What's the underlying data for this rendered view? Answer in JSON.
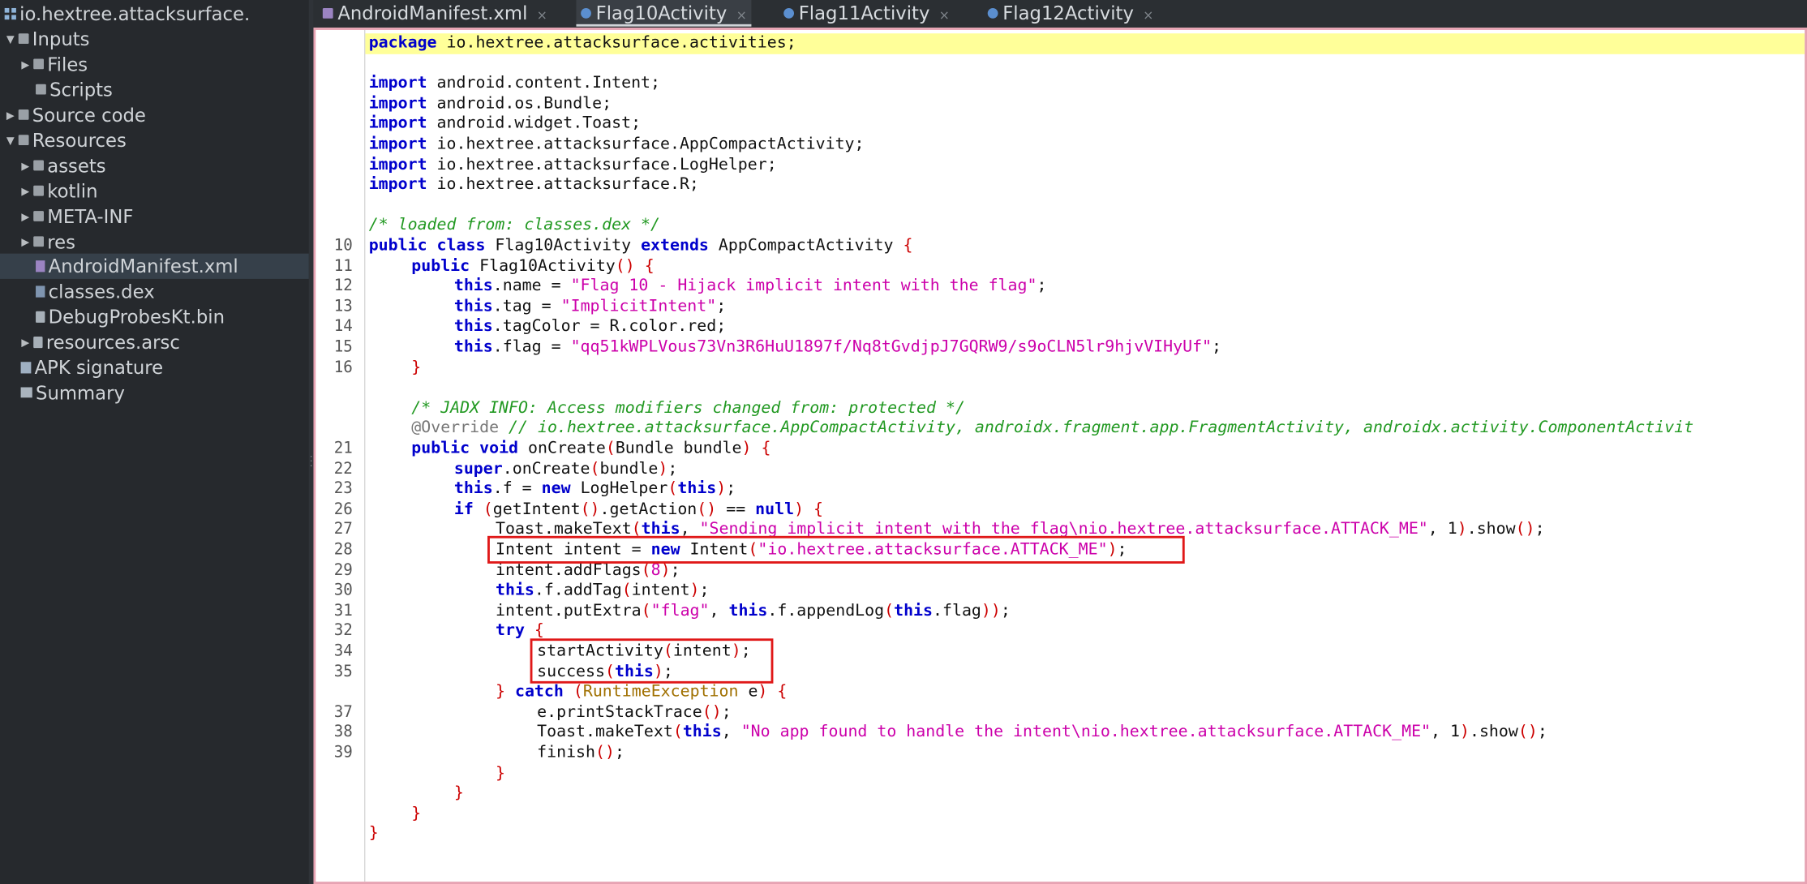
{
  "sidebar": {
    "root_label": "io.hextree.attacksurface.",
    "items": [
      {
        "label": "Inputs"
      },
      {
        "label": "Files"
      },
      {
        "label": "Scripts"
      },
      {
        "label": "Source code"
      },
      {
        "label": "Resources"
      },
      {
        "label": "assets"
      },
      {
        "label": "kotlin"
      },
      {
        "label": "META-INF"
      },
      {
        "label": "res"
      },
      {
        "label": "AndroidManifest.xml"
      },
      {
        "label": "classes.dex"
      },
      {
        "label": "DebugProbesKt.bin"
      },
      {
        "label": "resources.arsc"
      },
      {
        "label": "APK signature"
      },
      {
        "label": "Summary"
      }
    ]
  },
  "tabs": [
    {
      "label": "AndroidManifest.xml",
      "close": "×"
    },
    {
      "label": "Flag10Activity",
      "close": "×"
    },
    {
      "label": "Flag11Activity",
      "close": "×"
    },
    {
      "label": "Flag12Activity",
      "close": "×"
    }
  ],
  "code": {
    "line_numbers": [
      "10",
      "11",
      "12",
      "13",
      "14",
      "15",
      "16",
      "21",
      "22",
      "23",
      "26",
      "27",
      "28",
      "29",
      "30",
      "31",
      "32",
      "34",
      "35",
      "37",
      "38",
      "39"
    ],
    "package_kw": "package",
    "package_name": " io.hextree.attacksurface.activities;",
    "imports": [
      " android.content.Intent;",
      " android.os.Bundle;",
      " android.widget.Toast;",
      " io.hextree.attacksurface.AppCompactActivity;",
      " io.hextree.attacksurface.LogHelper;",
      " io.hextree.attacksurface.R;"
    ],
    "import_kw": "import",
    "loaded_comment": "/* loaded from: classes.dex */",
    "class_decl": {
      "public": "public",
      "class": "class",
      "name": " Flag10Activity ",
      "extends": "extends",
      "parent": " AppCompactActivity ",
      "open": "{"
    },
    "ctor": {
      "public": "public",
      "name": " Flag10Activity",
      "parens": "()",
      "open": " {"
    },
    "field_lines": [
      {
        "this": "this",
        "rest": ".name = ",
        "val": "\"Flag 10 - Hijack implicit intent with the flag\"",
        "end": ";"
      },
      {
        "this": "this",
        "rest": ".tag = ",
        "val": "\"ImplicitIntent\"",
        "end": ";"
      },
      {
        "this": "this",
        "rest": ".tagColor = R.color.red;",
        "val": "",
        "end": ""
      },
      {
        "this": "this",
        "rest": ".flag = ",
        "val": "\"qq51kWPLVous73Vn3R6HuU1897f/Nq8tGvdjpJ7GQRW9/s9oCLN5lr9hjvVIHyUf\"",
        "end": ";"
      }
    ],
    "close_brace": "}",
    "jadx_comment": "/* JADX INFO: Access modifiers changed from: protected */",
    "override": "@Override",
    "override_comment": " // io.hextree.attacksurface.AppCompactActivity, androidx.fragment.app.FragmentActivity, androidx.activity.ComponentActivit",
    "oncreate": {
      "public": "public",
      "void": "void",
      "name": " onCreate",
      "param": "Bundle bundle",
      "open": " {"
    },
    "super_kw": "super",
    "super_rest": ".onCreate",
    "super_arg": "bundle",
    "logf_this": "this",
    "logf_mid": ".f = ",
    "logf_new": "new",
    "logf_cls": " LogHelper",
    "logf_arg": "this",
    "if_kw": "if",
    "if_call1": "getIntent",
    "if_call2": ".getAction",
    "if_eq": " == ",
    "if_null": "null",
    "toast1_pre": "Toast.makeText",
    "toast1_this": "this",
    "toast1_str": "\"Sending implicit intent with the flag\\nio.hextree.attacksurface.ATTACK_ME\"",
    "toast1_post": ", 1",
    "toast_show": ".show",
    "intent_decl_pre": "Intent intent = ",
    "intent_new": "new",
    "intent_cls": " Intent",
    "intent_str": "\"io.hextree.attacksurface.ATTACK_ME\"",
    "addflags": "intent.addFlags",
    "addflags_arg": "8",
    "addtag_this": "this",
    "addtag_rest": ".f.addTag",
    "addtag_arg": "intent",
    "putextra": "intent.putExtra",
    "putextra_str": "\"flag\"",
    "putextra_this": "this",
    "putextra_mid": ".f.appendLog",
    "putextra_this2": "this",
    "putextra_end": ".flag",
    "try_kw": "try",
    "start_activity": "startActivity",
    "start_arg": "intent",
    "success": "success",
    "success_arg": "this",
    "catch_kw": "catch",
    "catch_type": "RuntimeException",
    "catch_var": " e",
    "print_stack": "e.printStackTrace",
    "toast2_pre": "Toast.makeText",
    "toast2_this": "this",
    "toast2_str": "\"No app found to handle the intent\\nio.hextree.attacksurface.ATTACK_ME\"",
    "toast2_post": ", 1",
    "finish": "finish"
  },
  "colors": {
    "keyword": "#0000cc",
    "string": "#cc00aa",
    "comment": "#229922",
    "highlight_box": "#e01818",
    "current_line": "#ffff99"
  }
}
